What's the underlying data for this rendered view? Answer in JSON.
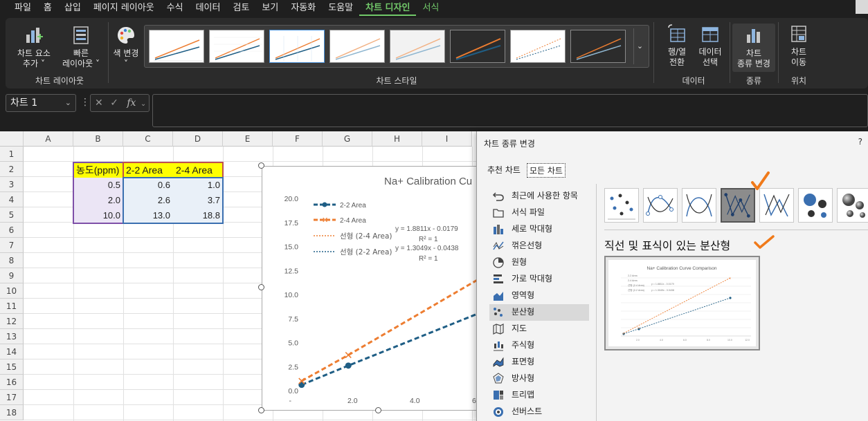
{
  "menu": {
    "tabs": [
      "파일",
      "홈",
      "삽입",
      "페이지 레이아웃",
      "수식",
      "데이터",
      "검토",
      "보기",
      "자동화",
      "도움말",
      "차트 디자인",
      "서식"
    ],
    "active": "차트 디자인"
  },
  "ribbon": {
    "add_element": [
      "차트 요소",
      "추가 ˅"
    ],
    "quick_layout": [
      "빠른",
      "레이아웃 ˅"
    ],
    "change_colors": [
      "색 변경",
      "˅"
    ],
    "group_layouts": "차트 레이아웃",
    "group_styles": "차트 스타일",
    "switch_rowcol": [
      "행/열",
      "전환"
    ],
    "select_data": [
      "데이터",
      "선택"
    ],
    "group_data": "데이터",
    "change_type": [
      "차트",
      "종류 변경"
    ],
    "group_type": "종류",
    "move_chart": [
      "차트",
      "이동"
    ],
    "group_location": "위치"
  },
  "formula": {
    "name_box": "차트 1",
    "fx": "fx"
  },
  "sheet": {
    "columns": [
      "A",
      "B",
      "C",
      "D",
      "E",
      "F",
      "G",
      "H",
      "I"
    ],
    "rows": [
      "1",
      "2",
      "3",
      "4",
      "5",
      "6",
      "7",
      "8",
      "9",
      "10",
      "11",
      "12",
      "13",
      "14",
      "15",
      "16",
      "17",
      "18"
    ],
    "headers": [
      "농도(ppm)",
      "2-2 Area",
      "2-4 Area"
    ],
    "data": [
      [
        "0.5",
        "0.6",
        "1.0"
      ],
      [
        "2.0",
        "2.6",
        "3.7"
      ],
      [
        "10.0",
        "13.0",
        "18.8"
      ]
    ]
  },
  "chart_data": {
    "type": "scatter",
    "title": "Na+ Calibration Cu",
    "x": [
      0.5,
      2.0,
      10.0
    ],
    "series": [
      {
        "name": "2-2 Area",
        "values": [
          0.6,
          2.6,
          13.0
        ],
        "color": "#1f5e85"
      },
      {
        "name": "2-4 Area",
        "values": [
          1.0,
          3.7,
          18.8
        ],
        "color": "#ed7d31"
      }
    ],
    "trendlines": [
      {
        "name": "선형 (2-4 Area)",
        "equation": "y = 1.8811x - 0.0179",
        "r2": "R² = 1"
      },
      {
        "name": "선형 (2-2 Area)",
        "equation": "y = 1.3049x - 0.0438",
        "r2": "R² = 1"
      }
    ],
    "yticks": [
      "20.0",
      "17.5",
      "15.0",
      "12.5",
      "10.0",
      "7.5",
      "5.0",
      "2.5",
      "0.0"
    ],
    "xticks": [
      "-",
      "2.0",
      "4.0",
      "6.0"
    ],
    "ylim": [
      0,
      20
    ],
    "xlim": [
      0,
      6.5
    ],
    "legend": "top-left",
    "grid": false
  },
  "dialog": {
    "title": "차트 종류 변경",
    "help": "?",
    "tabs": [
      "추천 차트",
      "모든 차트"
    ],
    "selected_tab": "모든 차트",
    "chart_types": [
      "최근에 사용한 항목",
      "서식 파일",
      "세로 막대형",
      "꺾은선형",
      "원형",
      "가로 막대형",
      "영역형",
      "분산형",
      "지도",
      "주식형",
      "표면형",
      "방사형",
      "트리맵",
      "선버스트"
    ],
    "selected_type": "분산형",
    "subtype_name": "직선 및 표식이 있는 분산형",
    "preview_title": "Na+ Calibration Curve Comparison",
    "annotation_color": "#f07a1a"
  }
}
